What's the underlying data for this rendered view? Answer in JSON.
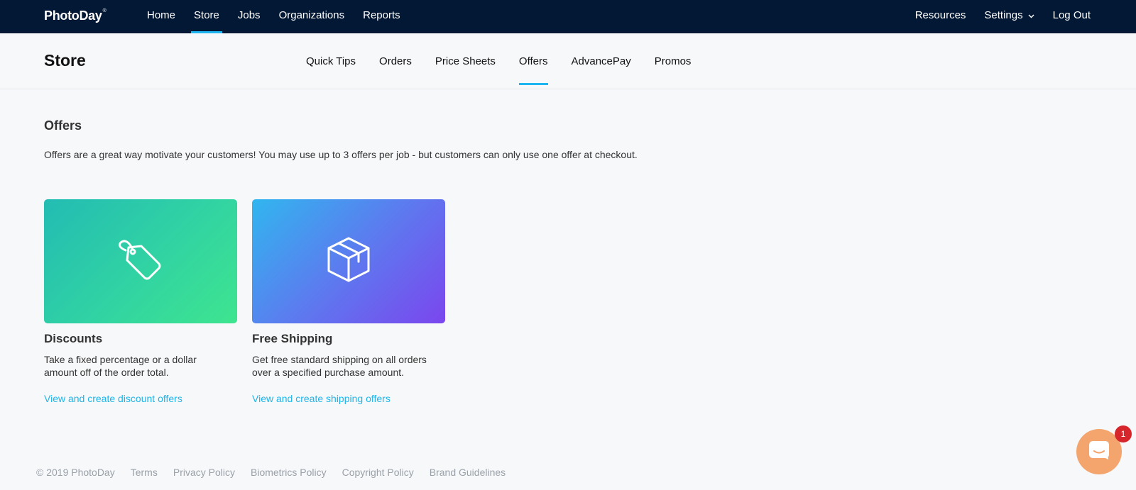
{
  "brand": {
    "logo": "PhotoDay",
    "trademark": "®"
  },
  "topnav": {
    "left": [
      "Home",
      "Store",
      "Jobs",
      "Organizations",
      "Reports"
    ],
    "right": {
      "resources": "Resources",
      "settings": "Settings",
      "logout": "Log Out"
    },
    "active": "Store"
  },
  "subheader": {
    "title": "Store",
    "tabs": [
      "Quick Tips",
      "Orders",
      "Price Sheets",
      "Offers",
      "AdvancePay",
      "Promos"
    ],
    "active_tab": "Offers"
  },
  "main": {
    "title": "Offers",
    "description": "Offers are a great way motivate your customers! You may use up to 3 offers per job - but customers can only use one offer at checkout.",
    "cards": [
      {
        "icon": "tag-icon",
        "title": "Discounts",
        "desc_line1": "Take a fixed percentage or a dollar",
        "desc_line2": "amount off of the order total.",
        "link": "View and create discount offers"
      },
      {
        "icon": "box-icon",
        "title": "Free Shipping",
        "desc_line1": "Get free standard shipping on all orders",
        "desc_line2": "over a specified purchase amount.",
        "link": "View and create shipping offers"
      }
    ]
  },
  "footer": {
    "copyright": "© 2019 PhotoDay",
    "links": [
      "Terms",
      "Privacy Policy",
      "Biometrics Policy",
      "Copyright Policy",
      "Brand Guidelines"
    ]
  },
  "chat": {
    "badge": "1",
    "icon": "chat-icon"
  },
  "colors": {
    "nav_bg": "#031834",
    "accent": "#1fb5f0",
    "link": "#1fb5ea",
    "chat": "#f3a56d",
    "badge": "#d6262b"
  }
}
